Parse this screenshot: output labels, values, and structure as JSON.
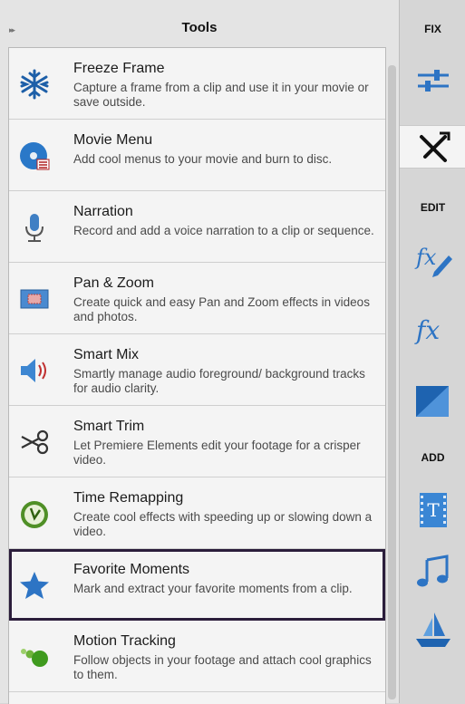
{
  "panel": {
    "title": "Tools"
  },
  "tools": [
    {
      "name": "Freeze Frame",
      "description": "Capture a frame from a clip and use it in your movie or save outside.",
      "icon": "snowflake-icon"
    },
    {
      "name": "Movie Menu",
      "description": "Add cool menus to your movie and burn to disc.",
      "icon": "disc-menu-icon"
    },
    {
      "name": "Narration",
      "description": "Record and add a voice narration to a clip or sequence.",
      "icon": "microphone-icon"
    },
    {
      "name": "Pan & Zoom",
      "description": "Create quick and easy Pan and Zoom effects in videos and photos.",
      "icon": "pan-zoom-icon"
    },
    {
      "name": "Smart Mix",
      "description": "Smartly manage audio foreground/ background tracks for audio clarity.",
      "icon": "speaker-icon"
    },
    {
      "name": "Smart Trim",
      "description": "Let Premiere Elements edit your footage for a crisper video.",
      "icon": "scissors-icon"
    },
    {
      "name": "Time Remapping",
      "description": "Create cool effects with speeding up or slowing down a video.",
      "icon": "clock-icon"
    },
    {
      "name": "Favorite Moments",
      "description": "Mark and extract your favorite moments from a clip.",
      "icon": "star-icon"
    },
    {
      "name": "Motion Tracking",
      "description": "Follow objects in your footage and attach cool graphics to them.",
      "icon": "motion-dots-icon"
    }
  ],
  "selected_tool": "Favorite Moments",
  "rail": {
    "fix_label": "FIX",
    "edit_label": "EDIT",
    "add_label": "ADD",
    "buttons": [
      {
        "name": "adjust",
        "icon": "sliders-icon"
      },
      {
        "name": "tools",
        "icon": "tools-icon",
        "active": true
      },
      {
        "name": "applied-effects",
        "icon": "fx-pencil-icon"
      },
      {
        "name": "effects",
        "icon": "fx-icon"
      },
      {
        "name": "transitions",
        "icon": "transition-icon"
      },
      {
        "name": "titles",
        "icon": "title-t-icon"
      },
      {
        "name": "music",
        "icon": "music-note-icon"
      },
      {
        "name": "graphics",
        "icon": "sailboat-icon"
      }
    ]
  },
  "colors": {
    "accent_blue": "#2d74c4",
    "selection_outline": "#2b1d3b"
  }
}
